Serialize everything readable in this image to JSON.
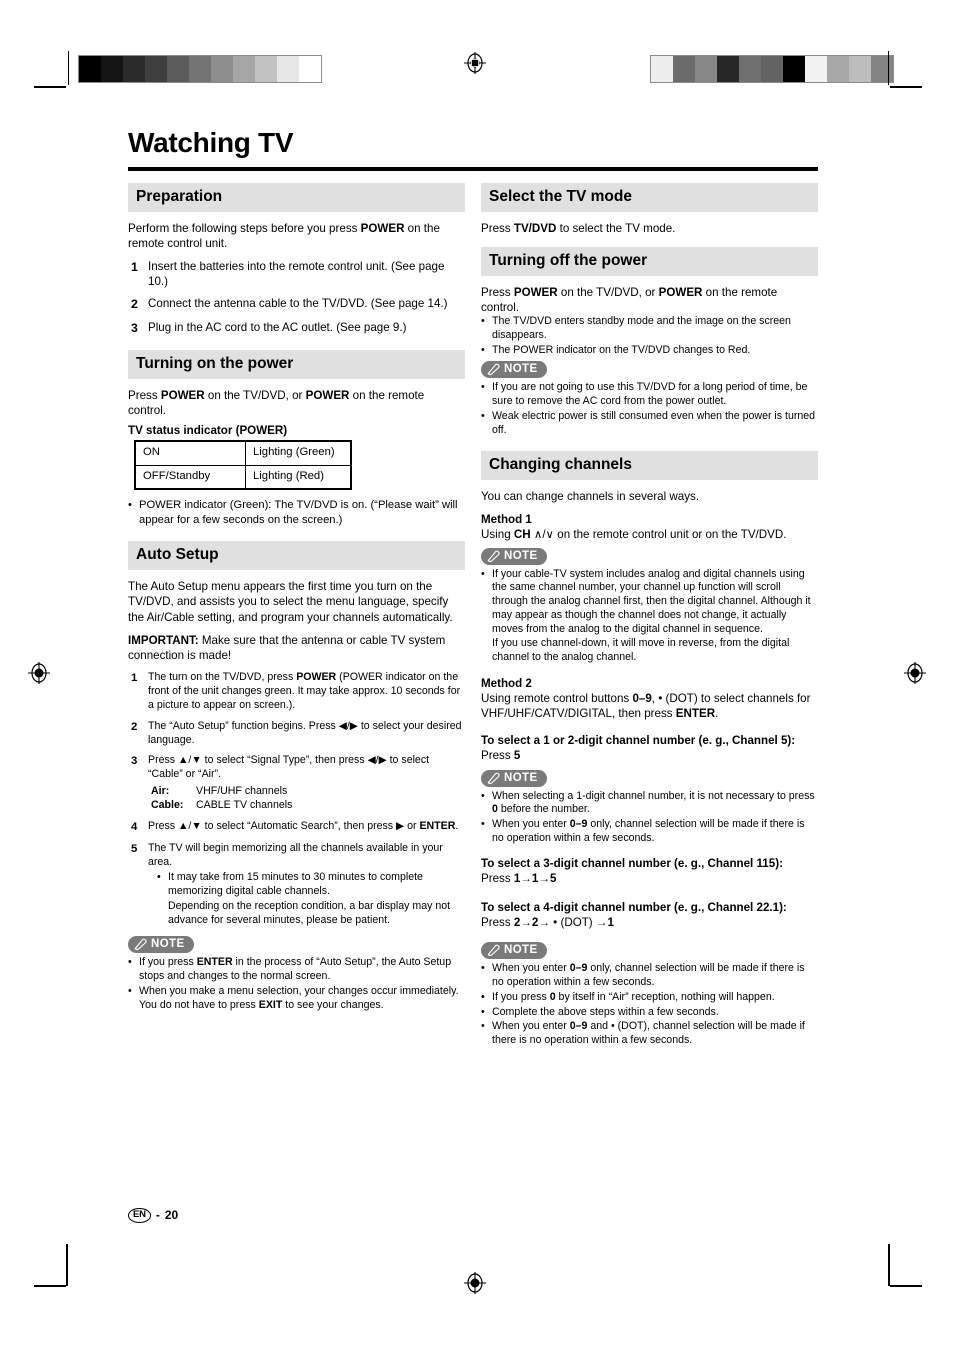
{
  "page": {
    "title": "Watching TV",
    "footer_locale": "EN",
    "footer_sep": "-",
    "footer_page": "20"
  },
  "left_column": {
    "preparation": {
      "heading": "Preparation",
      "intro_plain_1": "Perform the following steps before you press ",
      "intro_bold": "POWER",
      "intro_plain_2": " on the remote control unit.",
      "steps": [
        {
          "num": "1",
          "text": "Insert the batteries into the remote control unit. (See page 10.)"
        },
        {
          "num": "2",
          "text": "Connect the antenna cable to the TV/DVD. (See page 14.)"
        },
        {
          "num": "3",
          "text": "Plug in the AC cord to the AC outlet. (See page 9.)"
        }
      ]
    },
    "turning_on": {
      "heading": "Turning on the power",
      "intro_p1": "Press ",
      "intro_b1": "POWER",
      "intro_p2": " on the TV/DVD, or ",
      "intro_b2": "POWER",
      "intro_p3": " on the remote control.",
      "table_title": "TV status indicator (POWER)",
      "table_rows": [
        {
          "state": "ON",
          "indicator": "Lighting (Green)"
        },
        {
          "state": "OFF/Standby",
          "indicator": "Lighting (Red)"
        }
      ],
      "bullet": "POWER indicator (Green): The TV/DVD is on. (“Please wait” will appear for a few seconds on the screen.)"
    },
    "auto_setup": {
      "heading": "Auto Setup",
      "intro": "The Auto Setup menu appears the first time you turn on the TV/DVD, and assists you to select the menu language, specify the Air/Cable setting, and program your channels automatically.",
      "important_label": "IMPORTANT:",
      "important_text": " Make sure that the antenna or cable TV system connection is made!",
      "step1_num": "1",
      "step1_p1": "The turn on the TV/DVD, press ",
      "step1_b": "POWER",
      "step1_p2": " (POWER indicator on the front of the unit changes green. It may take approx. 10 seconds for a picture to appear on screen.).",
      "step2_num": "2",
      "step2_p1": "The “Auto Setup” function begins. Press ",
      "step2_arrows": "◀/▶",
      "step2_p2": " to select your desired language.",
      "step3_num": "3",
      "step3_p1": "Press ",
      "step3_arrows_a": "▲/▼",
      "step3_p2": " to select “Signal Type”, then press ",
      "step3_arrows_b": "◀/▶",
      "step3_p3": " to select “Cable” or “Air”.",
      "step3_kv": [
        {
          "k": "Air:",
          "v": "VHF/UHF channels"
        },
        {
          "k": "Cable:",
          "v": "CABLE TV channels"
        }
      ],
      "step4_num": "4",
      "step4_p1": "Press ",
      "step4_arrows": "▲/▼",
      "step4_p2": " to select “Automatic Search”, then press ",
      "step4_arrow_r": "▶",
      "step4_p3": " or ",
      "step4_b": "ENTER",
      "step4_p4": ".",
      "step5_num": "5",
      "step5_text": "The TV will begin memorizing all the channels available in your area.",
      "step5_bullets": [
        "It may take from 15 minutes to 30 minutes to complete memorizing digital cable channels.",
        "Depending on the reception condition, a bar display may not advance for several minutes, please be patient."
      ]
    },
    "note_auto_setup": {
      "badge": "NOTE",
      "bullets": [
        {
          "p1": "If you press ",
          "b1": "ENTER",
          "p2": " in the process of “Auto Setup”, the Auto Setup stops and changes to the normal screen."
        },
        {
          "p1": "When you make a menu selection, your changes occur immediately. You do not have to press ",
          "b1": "EXIT",
          "p2": " to see your changes."
        }
      ]
    }
  },
  "right_column": {
    "select_tv_mode": {
      "heading": "Select the TV mode",
      "p1": "Press ",
      "b1": "TV/DVD",
      "p2": " to select the TV mode."
    },
    "turning_off": {
      "heading": "Turning off the power",
      "p1": "Press ",
      "b1": "POWER",
      "p2": " on the TV/DVD, or ",
      "b2": "POWER",
      "p3": " on the remote control.",
      "bullets": [
        "The TV/DVD enters standby mode and the image on the screen disappears.",
        "The POWER indicator on the TV/DVD changes to Red."
      ]
    },
    "note_turning_off": {
      "badge": "NOTE",
      "bullets": [
        "If you are not going to use this TV/DVD for a long period of time, be sure to remove the AC cord from the power outlet.",
        "Weak electric power is still consumed even when the power is turned off."
      ]
    },
    "changing_channels": {
      "heading": "Changing channels",
      "intro": "You can change channels in several ways.",
      "method1_label": "Method 1",
      "method1_p1": "Using ",
      "method1_b1": "CH",
      "method1_glyph": " ∧/∨ ",
      "method1_p2": "on the remote control unit or on the TV/DVD.",
      "note1": {
        "badge": "NOTE",
        "bullets": [
          "If your cable-TV system includes analog and digital channels using the same channel number, your channel up function will scroll through the analog channel first, then the digital channel. Although it may appear as though the channel does not change, it actually moves from the analog to the digital channel in sequence.",
          "If you use channel-down, it will move in reverse, from the digital channel to the analog channel."
        ]
      },
      "method2_label": "Method 2",
      "method2_p1": "Using remote control buttons ",
      "method2_b1": "0–9",
      "method2_p2": ", • (DOT) to select channels for VHF/UHF/CATV/DIGITAL, then press ",
      "method2_b2": "ENTER",
      "method2_p3": ".",
      "digit12_head": "To select a 1 or 2-digit channel number (e. g., Channel 5):",
      "digit12_p": "Press ",
      "digit12_b": "5",
      "note2": {
        "badge": "NOTE",
        "bullets": [
          {
            "p1": "When selecting a 1-digit channel number, it is not necessary to press ",
            "b1": "0",
            "p2": " before the number."
          },
          {
            "p1": "When you enter ",
            "b1": "0–9",
            "p2": " only, channel selection will be made if there is no operation within a few seconds."
          }
        ]
      },
      "digit3_head": "To select a 3-digit channel number (e. g., Channel 115):",
      "digit3_p": "Press ",
      "digit3_b": "1→1→5",
      "digit4_head": "To select a 4-digit channel number (e. g., Channel 22.1):",
      "digit4_p": "Press ",
      "digit4_b1": "2→2→",
      "digit4_mid": " • (DOT) ",
      "digit4_b2": "→1",
      "note3": {
        "badge": "NOTE",
        "bullets": [
          {
            "p1": "When you enter ",
            "b1": "0–9",
            "p2": " only, channel selection will be made if there is no operation within a few seconds."
          },
          {
            "p1": "If you press ",
            "b1": "0",
            "p2": " by itself in “Air” reception, nothing will happen."
          },
          {
            "p1": "Complete the above steps within a few seconds.",
            "b1": "",
            "p2": ""
          },
          {
            "p1": "When you enter ",
            "b1": "0–9",
            "p2": " and • (DOT), channel selection will be made if there is no operation within a few seconds."
          }
        ]
      }
    }
  },
  "print_marks": {
    "left_strip_colors": [
      "#000000",
      "#141414",
      "#2b2b2b",
      "#3f3f3f",
      "#5c5c5c",
      "#737373",
      "#8e8e8e",
      "#a6a6a6",
      "#c2c2c2",
      "#e6e6e6",
      "#ffffff"
    ],
    "right_strip_colors": [
      "#ededed",
      "#6b6b6b",
      "#878787",
      "#272727",
      "#6f6f6f",
      "#636363",
      "#000000",
      "#f2f2f2",
      "#a8a8a8",
      "#bdbdbd",
      "#848484"
    ]
  }
}
